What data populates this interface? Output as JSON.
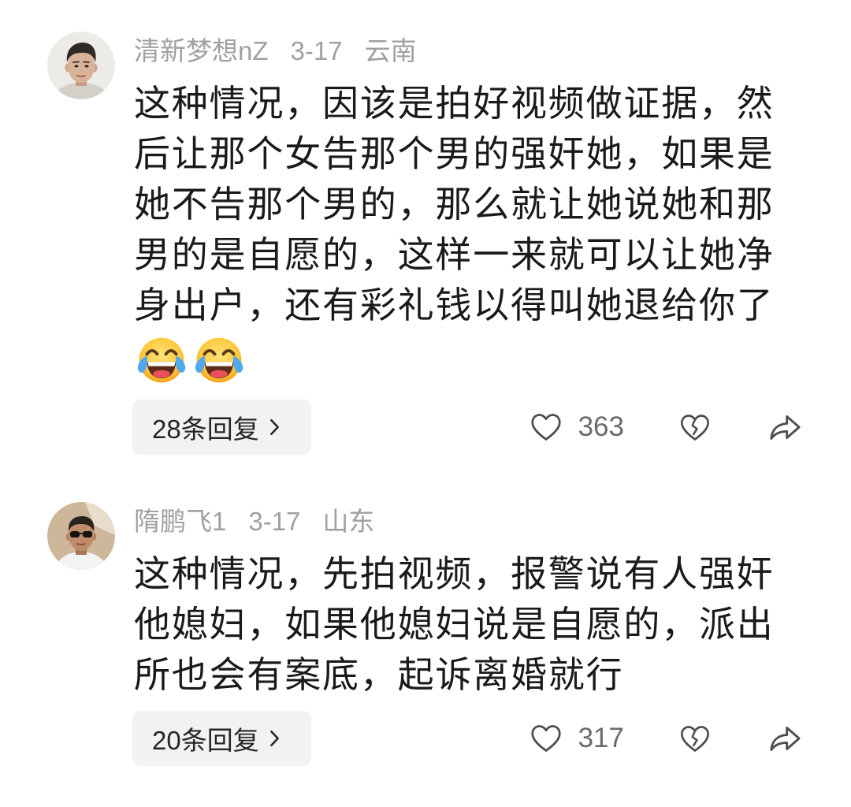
{
  "comments": [
    {
      "username": "清新梦想nZ",
      "date": "3-17",
      "location": "云南",
      "body_lines": [
        "这种情况，因该是拍好视频做证据，然",
        "后让那个女告那个男的强奸她，如果是",
        "她不告那个男的，那么就让她说她和那",
        "男的是自愿的，这样一来就可以让她净",
        "身出户，还有彩礼钱以得叫她退给你了"
      ],
      "emoji": [
        "face-with-tears-of-joy",
        "face-with-tears-of-joy"
      ],
      "reply_label": "28条回复",
      "like_count": "363"
    },
    {
      "username": "隋鹏飞1",
      "date": "3-17",
      "location": "山东",
      "body_lines": [
        "这种情况，先拍视频，报警说有人强奸",
        "他媳妇，如果他媳妇说是自愿的，派出",
        "所也会有案底，起诉离婚就行"
      ],
      "reply_label": "20条回复",
      "like_count": "317"
    }
  ],
  "icons": {
    "like": "heart-outline-icon",
    "dislike": "broken-heart-icon",
    "share": "share-arrow-icon",
    "reply_chevron": "chevron-right-icon"
  },
  "colors": {
    "text": "#1a1a1a",
    "meta": "#a0a0a0",
    "reply_bg": "#f2f2f2",
    "icon": "#4d4d4d",
    "count": "#6a6a6a"
  }
}
